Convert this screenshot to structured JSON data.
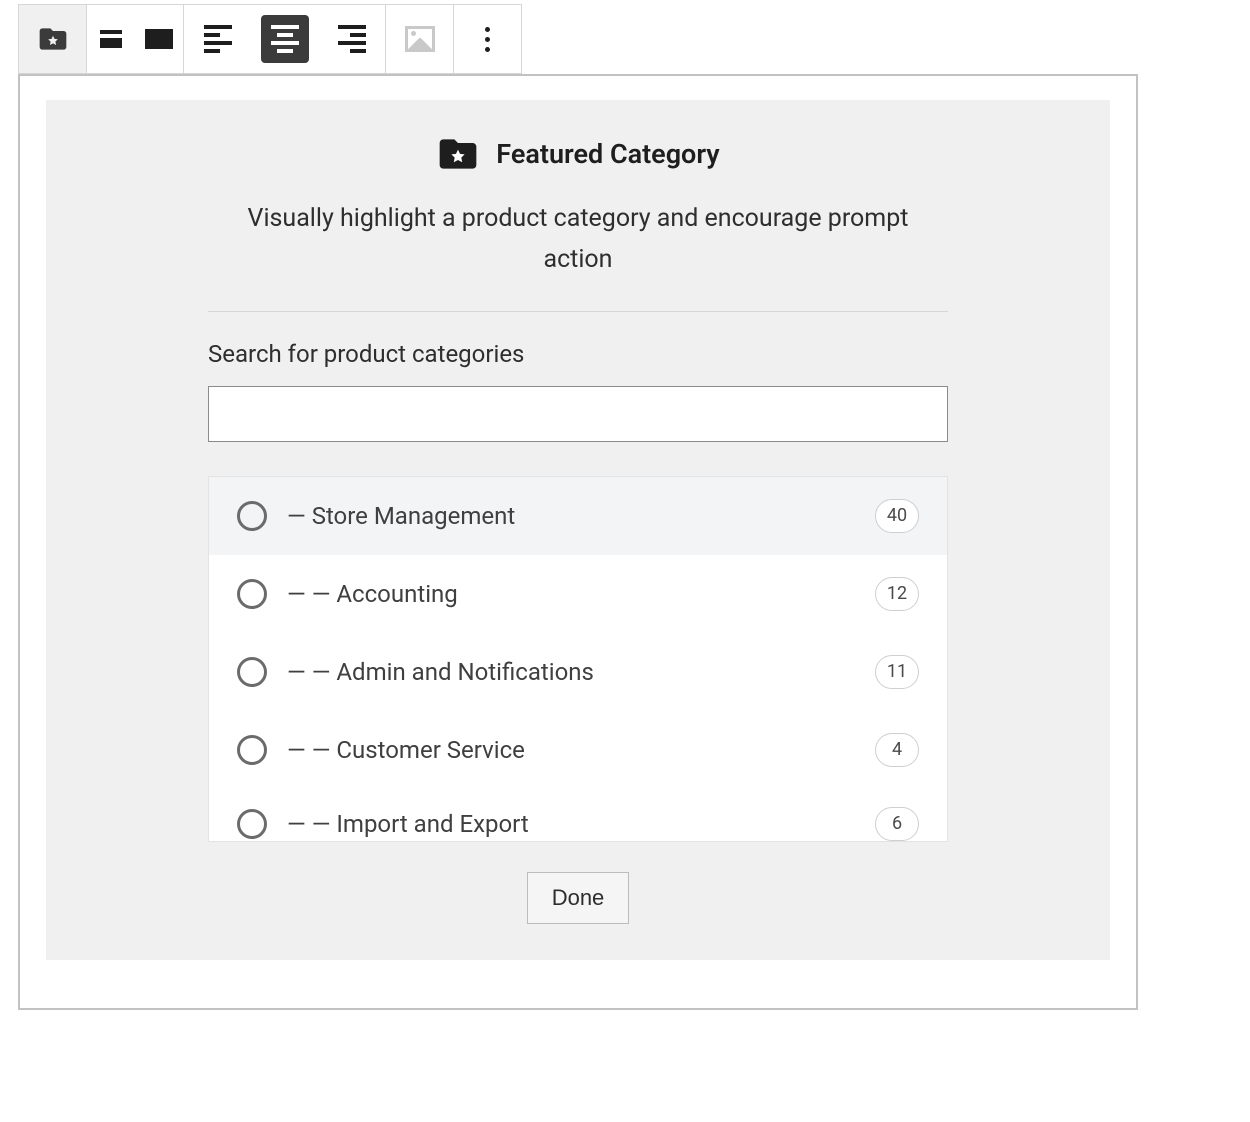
{
  "block": {
    "title": "Featured Category",
    "description": "Visually highlight a product category and encourage prompt action",
    "search_label": "Search for product categories",
    "search_value": "",
    "done_label": "Done",
    "categories": [
      {
        "prefix": "— ",
        "name": "Store Management",
        "count": "40",
        "hover": true
      },
      {
        "prefix": "— — ",
        "name": "Accounting",
        "count": "12",
        "hover": false
      },
      {
        "prefix": "— — ",
        "name": "Admin and Notifications",
        "count": "11",
        "hover": false
      },
      {
        "prefix": "— — ",
        "name": "Customer Service",
        "count": "4",
        "hover": false
      },
      {
        "prefix": "— — ",
        "name": "Import and Export",
        "count": "6",
        "hover": false
      }
    ]
  },
  "toolbar": {
    "block_type": "featured-category",
    "layout_half_selected": false,
    "layout_full_selected": false,
    "align": "center",
    "media_enabled": false
  }
}
